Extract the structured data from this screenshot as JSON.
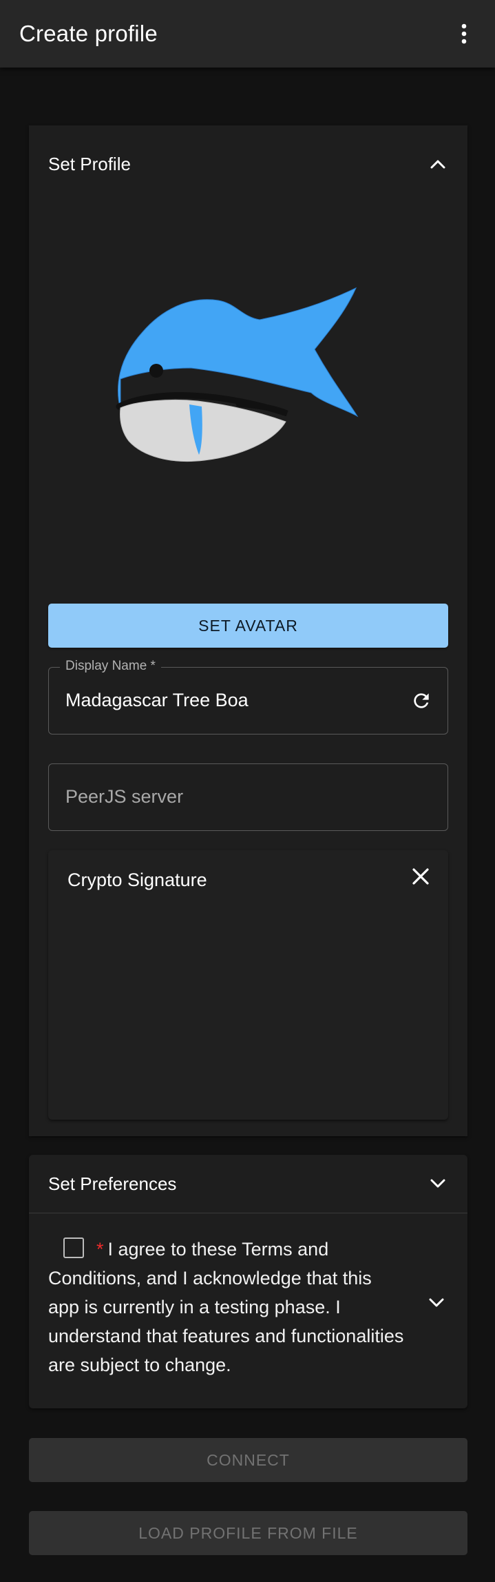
{
  "appbar": {
    "title": "Create profile",
    "menu_icon": "more-vert-icon"
  },
  "profile_section": {
    "title": "Set Profile",
    "collapse_icon": "chevron-up-icon",
    "avatar": {
      "description": "whale-avatar",
      "colors": {
        "body": "#42a5f5",
        "belly": "#d9d9d9",
        "outline": "#111111"
      }
    },
    "set_avatar_label": "SET AVATAR",
    "display_name": {
      "label": "Display Name *",
      "value": "Madagascar Tree Boa",
      "action_icon": "refresh-icon"
    },
    "peerjs": {
      "placeholder": "PeerJS server"
    },
    "crypto": {
      "title": "Crypto Signature",
      "close_icon": "close-icon"
    }
  },
  "preferences_section": {
    "title": "Set Preferences",
    "expand_icon": "chevron-down-icon",
    "terms": {
      "required_mark": "*",
      "text": "I agree to these Terms and Conditions, and I acknowledge that this app is currently in a testing phase. I understand that features and functionalities are subject to change.",
      "expand_icon": "chevron-down-icon"
    }
  },
  "actions": {
    "connect_label": "CONNECT",
    "load_label": "LOAD PROFILE FROM FILE"
  },
  "colors": {
    "background": "#121212",
    "surface": "#1e1e1e",
    "primary_button": "#90caf9",
    "required": "#ef2b2b",
    "disabled_text": "#727272"
  }
}
